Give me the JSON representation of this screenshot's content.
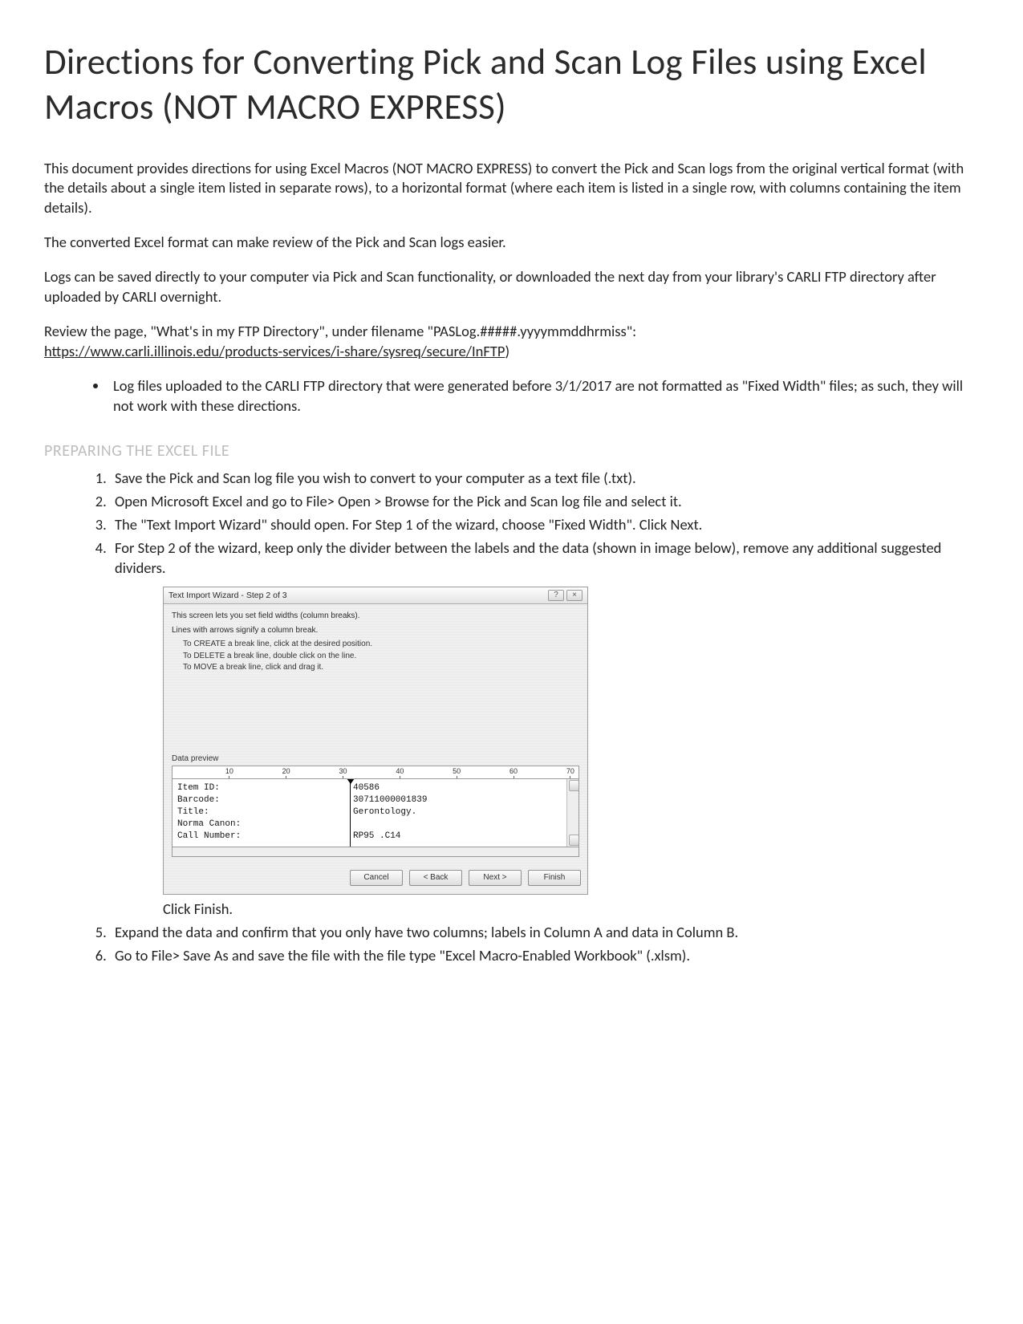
{
  "title": "Directions for Converting Pick and Scan Log Files using Excel Macros (NOT MACRO EXPRESS)",
  "paragraphs": {
    "p1": "This document provides directions for using Excel Macros (NOT MACRO EXPRESS) to convert the Pick and Scan logs from the original vertical format (with the details about a single item listed in separate rows), to a horizontal format (where each item is listed in a single row, with columns containing the item details).",
    "p2": "The converted Excel format can make review of the Pick and Scan logs easier.",
    "p3": "Logs can be saved directly to your computer via Pick and Scan functionality, or downloaded the next day from your library's CARLI FTP directory after uploaded by CARLI overnight.",
    "p4_pre": "Review the page, \"What's in my FTP Directory\", under filename \"PASLog.#####.yyyymmddhrmiss\":",
    "p4_link": "https://www.carli.illinois.edu/products-services/i-share/sysreq/secure/InFTP",
    "p4_post": ")"
  },
  "bullet1": "Log files uploaded to the CARLI FTP directory that were generated before 3/1/2017 are not formatted as \"Fixed Width\" files; as such, they will not work with these directions.",
  "sectionTitle": "PREPARING THE EXCEL FILE",
  "steps": {
    "s1": "Save the Pick and Scan log file you wish to convert to your computer as a text file (.txt).",
    "s2": "Open Microsoft Excel and go to File> Open > Browse for the Pick and Scan log file and select it.",
    "s3": "The \"Text Import Wizard\" should open. For Step 1 of the wizard, choose \"Fixed Width\". Click Next.",
    "s4": "For Step 2 of the wizard, keep only the divider between the labels and the data (shown in image below), remove any additional suggested dividers.",
    "s4b": "Click Finish.",
    "s5": "Expand the data and confirm that you only have two columns; labels in Column A and data in Column B.",
    "s6": "Go to File> Save As and save the file with the file type \"Excel Macro-Enabled Workbook\" (.xlsm)."
  },
  "wizard": {
    "title": "Text Import Wizard - Step 2 of 3",
    "desc1": "This screen lets you set field widths (column breaks).",
    "desc2": "Lines with arrows signify a column break.",
    "hint1": "To CREATE a break line, click at the desired position.",
    "hint2": "To DELETE a break line, double click on the line.",
    "hint3": "To MOVE a break line, click and drag it.",
    "previewLabel": "Data preview",
    "ruler": [
      "10",
      "20",
      "30",
      "40",
      "50",
      "60",
      "70"
    ],
    "colA": [
      "Item ID:",
      "Barcode:",
      "Title:",
      "Norma Canon:",
      "Call Number:"
    ],
    "colB": [
      "40586",
      "30711000001839",
      "Gerontology.",
      "",
      "RP95 .C14"
    ],
    "buttons": {
      "cancel": "Cancel",
      "back": "< Back",
      "next": "Next >",
      "finish": "Finish"
    }
  }
}
